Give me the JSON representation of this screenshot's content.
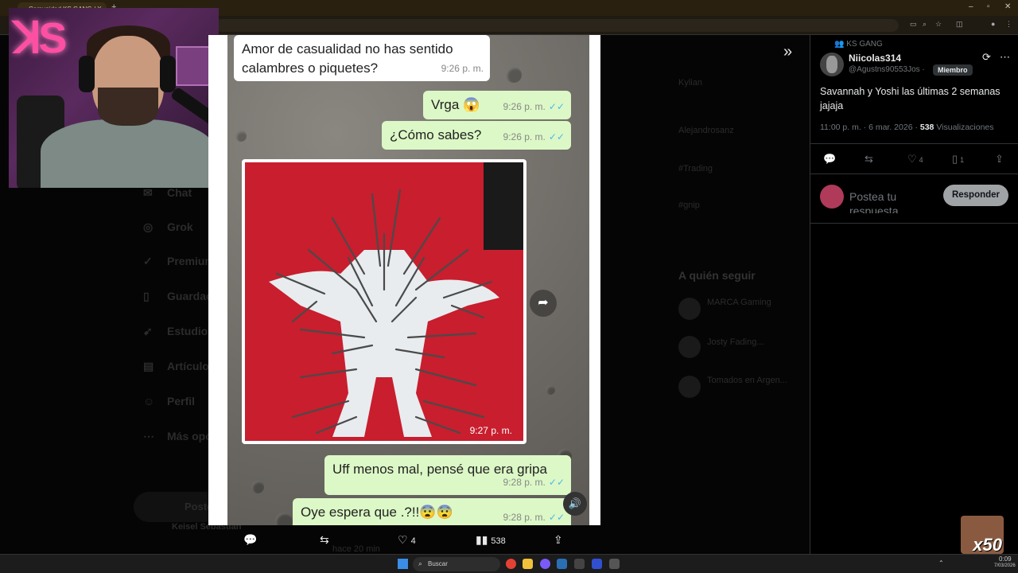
{
  "browser": {
    "tab_title": "Comunidad KS GANG / X",
    "new_tab": "+",
    "min": "–",
    "max": "▫",
    "close": "✕"
  },
  "background_page": {
    "nav": [
      "Chat",
      "Grok",
      "Premium",
      "Guardados",
      "Estudio",
      "Artículos",
      "Perfil",
      "Más opciones"
    ],
    "post_button": "Postear",
    "trends": [
      "Kylian",
      "Alejandrosanz",
      "#Trading",
      "#gnip"
    ],
    "follow_title": "A quién seguir",
    "follow": [
      "MARCA Gaming",
      "Josty Fading...",
      "Tomados en Argen..."
    ],
    "user": "Keisel Sebastián",
    "time_ago": "hace 20 min"
  },
  "media": {
    "messages": [
      {
        "dir": "in",
        "text_lines": [
          "Amor de casualidad no has sentido",
          "calambres o piquetes?"
        ],
        "time": "9:26 p. m."
      },
      {
        "dir": "out",
        "text": "Vrga 😱",
        "time": "9:26 p. m."
      },
      {
        "dir": "out",
        "text": "¿Cómo sabes?",
        "time": "9:26 p. m."
      },
      {
        "dir": "out",
        "text": "Uff menos mal, pensé que era gripa",
        "time": "9:28 p. m."
      },
      {
        "dir": "out",
        "text": "Oye espera que .?!!😨😨",
        "time": "9:28 p. m."
      }
    ],
    "photo_time": "9:27 p. m.",
    "ticks": "✓✓",
    "forward_icon": "➦",
    "volume_icon": "🔊"
  },
  "actions": {
    "likes": "4",
    "views": "538"
  },
  "panel": {
    "community": "KS GANG",
    "username": "Niicolas314",
    "handle": "@Agustns90553Jos ·",
    "badge": "Miembro",
    "text": "Savannah y Yoshi las últimas 2 semanas jajaja",
    "timestamp": "11:00 p. m. · 6 mar. 2026 ·",
    "views_count": "538",
    "views_label": "Visualizaciones",
    "likes": "4",
    "bookmarks": "1",
    "reply_placeholder": "Postea tu respuesta",
    "reply_button": "Responder"
  },
  "overlay": {
    "emote_text": "x50"
  },
  "taskbar": {
    "search_placeholder": "Buscar",
    "time": "0:09",
    "date": "7/03/2026"
  }
}
